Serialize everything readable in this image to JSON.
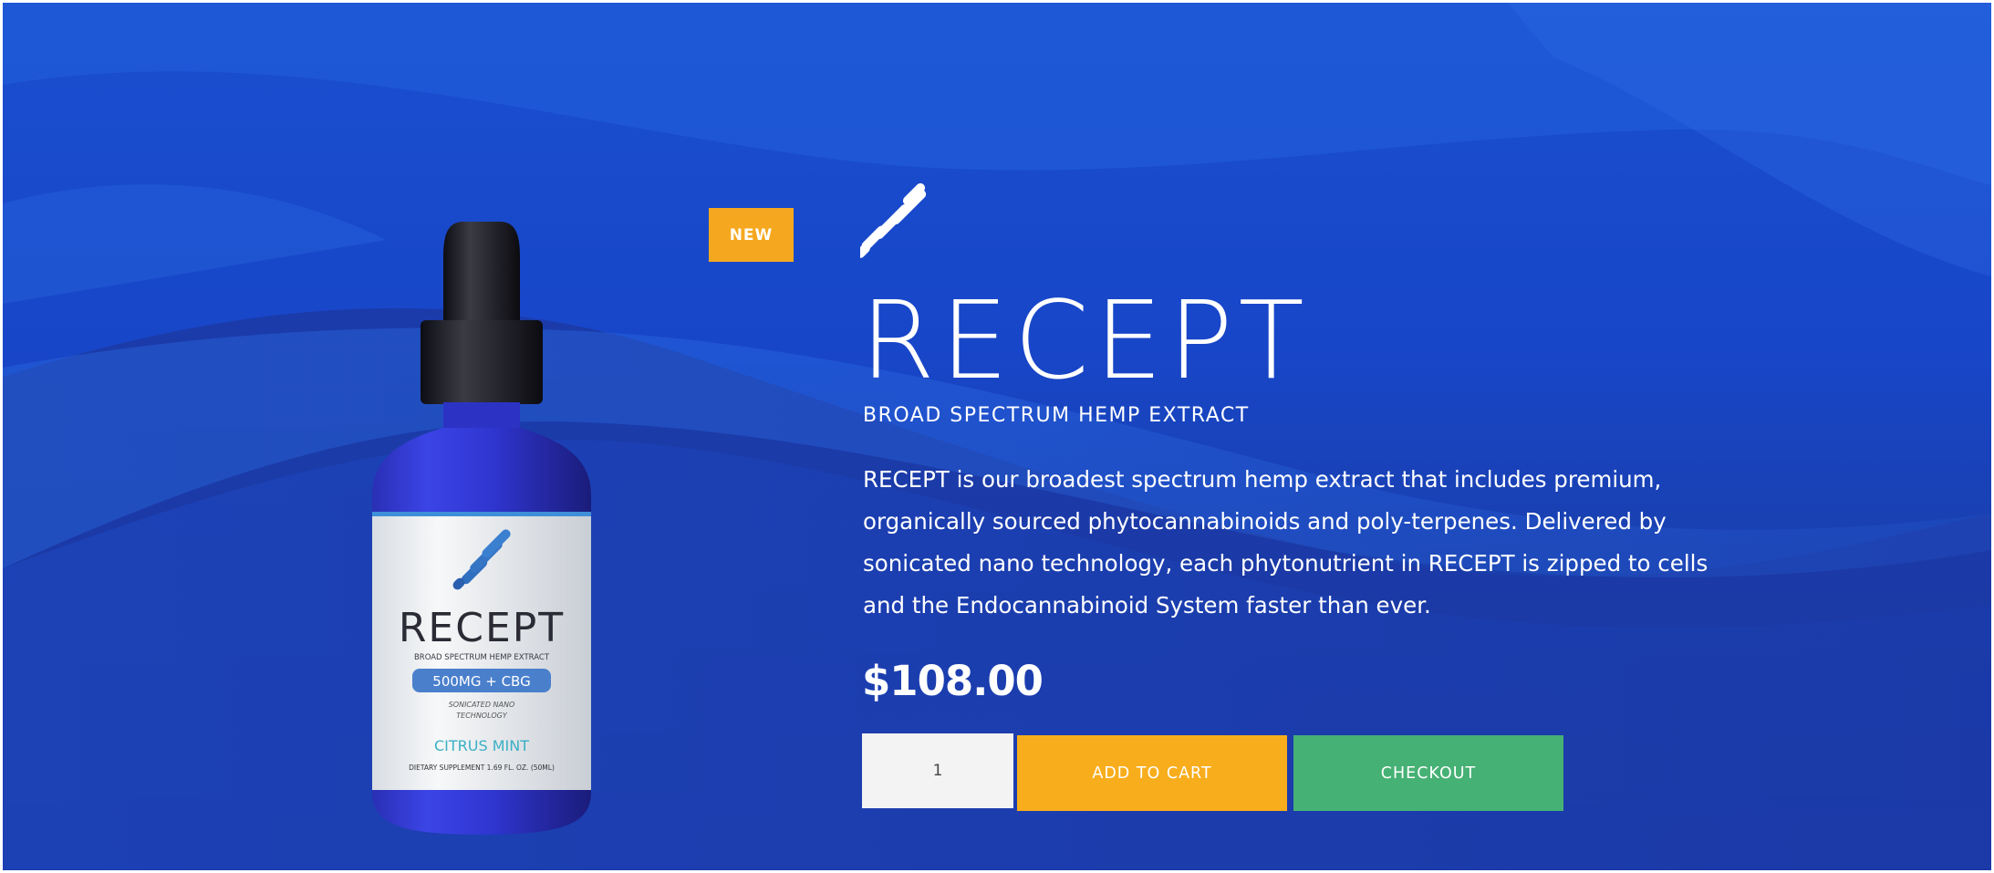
{
  "product": {
    "badge": "NEW",
    "name": "RECEPT",
    "subtitle": "BROAD SPECTRUM HEMP EXTRACT",
    "description": "RECEPT is our broadest spectrum hemp extract that includes premium, organically sourced phytocannabinoids and poly-terpenes. Delivered by sonicated nano technology, each phytonutrient in RECEPT is zipped to cells and the Endocannabinoid System faster than ever.",
    "price": "$108.00"
  },
  "label": {
    "brand": "RECEPT",
    "subtitle": "BROAD SPECTRUM HEMP EXTRACT",
    "dose": "500MG + CBG",
    "tech_line1": "SONICATED NANO",
    "tech_line2": "TECHNOLOGY",
    "flavor": "CITRUS MINT",
    "footer": "DIETARY SUPPLEMENT   1.69 FL. OZ. (50ML)"
  },
  "purchase": {
    "quantity": "1",
    "add_to_cart_label": "ADD TO CART",
    "checkout_label": "CHECKOUT"
  },
  "icons": {
    "brand": "recept-logo-icon"
  },
  "colors": {
    "background": "#1846c8",
    "badge": "#f5a81f",
    "add_to_cart": "#f8ad1c",
    "checkout": "#46b174"
  }
}
